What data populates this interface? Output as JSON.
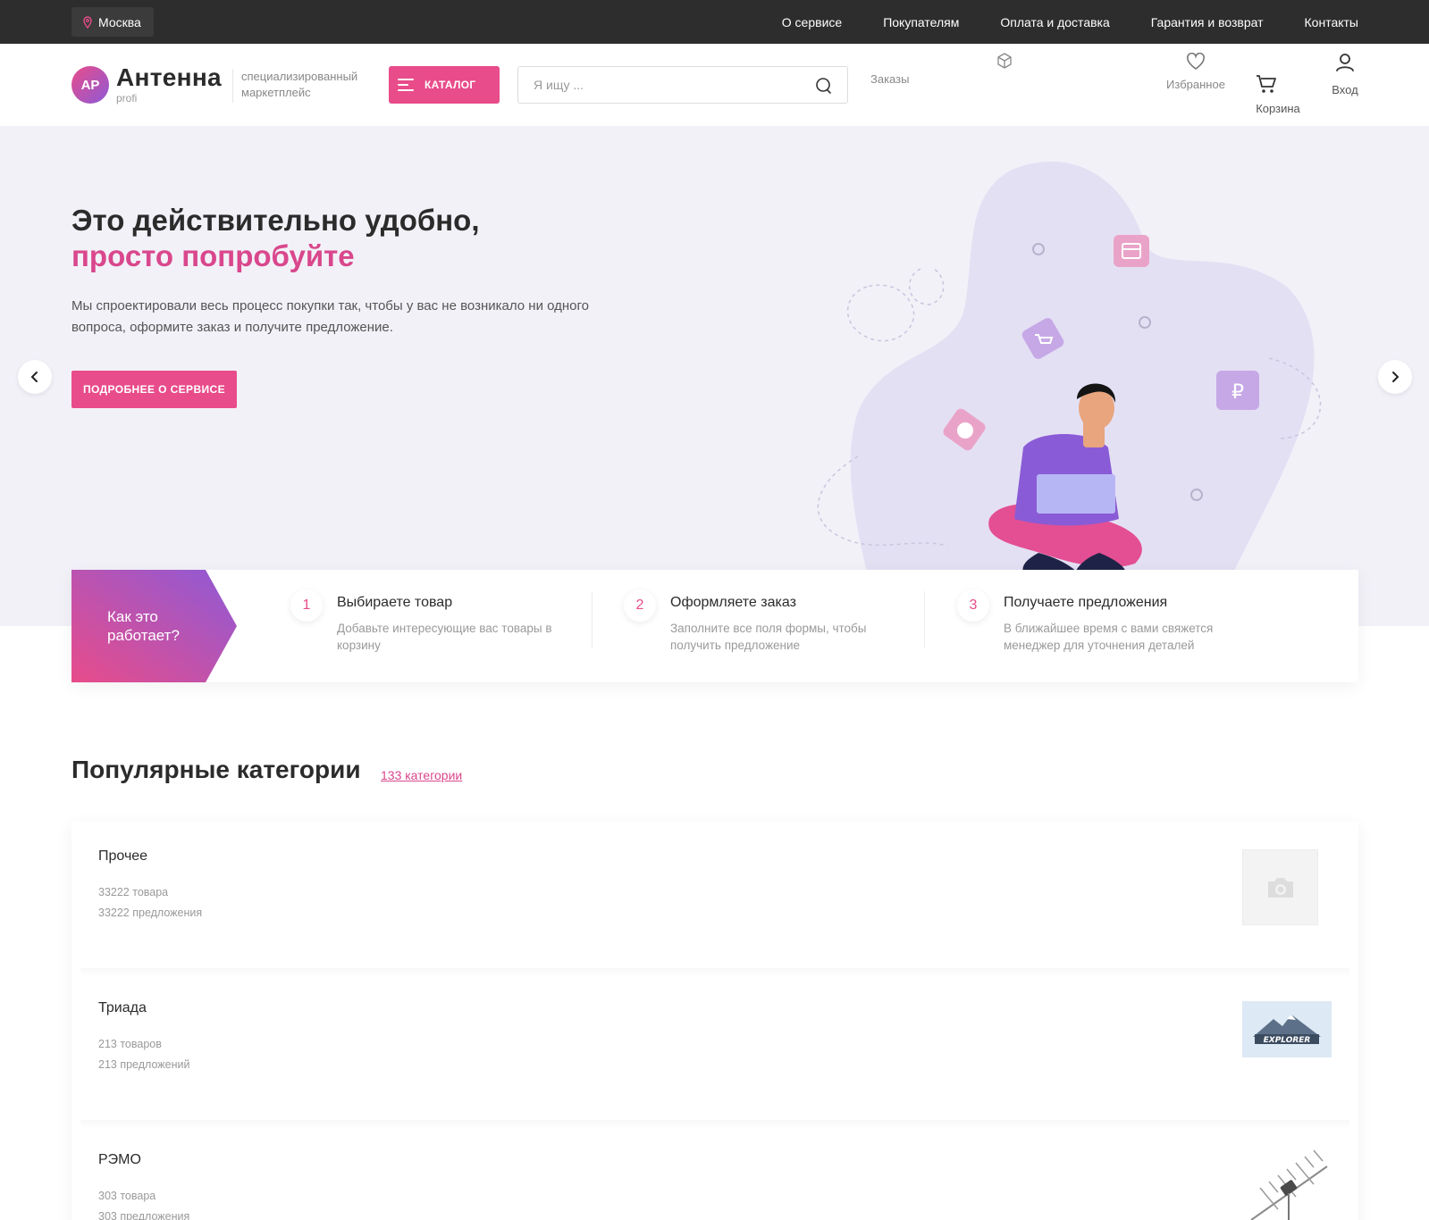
{
  "topbar": {
    "city": "Москва",
    "nav": [
      "О сервисе",
      "Покупателям",
      "Оплата и доставка",
      "Гарантия и возврат",
      "Контакты"
    ]
  },
  "header": {
    "logo_initials": "АР",
    "logo_name": "Антенна",
    "logo_sub": "profi",
    "tagline": "специализированный маркетплейс",
    "catalog_label": "КАТАЛОГ",
    "search_placeholder": "Я ищу ...",
    "orders_label": "Заказы",
    "favorites_label": "Избранное",
    "cart_label": "Корзина",
    "login_label": "Вход"
  },
  "hero": {
    "title_line1": "Это действительно удобно,",
    "title_line2": "просто попробуйте",
    "text": "Мы спроектировали весь процесс покупки так, чтобы у вас не возникало ни одного вопроса, оформите заказ и получите предложение.",
    "button": "ПОДРОБНЕЕ О СЕРВИСЕ"
  },
  "how": {
    "badge": "Как это работает?",
    "steps": [
      {
        "num": "1",
        "title": "Выбираете товар",
        "desc": "Добавьте интересующие вас товары в корзину"
      },
      {
        "num": "2",
        "title": "Оформляете заказ",
        "desc": "Заполните все поля формы, чтобы получить предложение"
      },
      {
        "num": "3",
        "title": "Получаете предложения",
        "desc": "В ближайшее время с вами свяжется менеджер для уточнения деталей"
      }
    ]
  },
  "popular": {
    "title": "Популярные категории",
    "link": "133 категории",
    "items": [
      {
        "name": "Прочее",
        "goods": "33222 товара",
        "offers": "33222 предложения"
      },
      {
        "name": "Триада",
        "goods": "213 товаров",
        "offers": "213 предложений",
        "brand_text": "EXPLORER"
      },
      {
        "name": "РЭМО",
        "goods": "303 товара",
        "offers": "303 предложения"
      }
    ]
  },
  "colors": {
    "accent": "#e84c8a",
    "accent_purple": "#8e5ad6",
    "topbar_bg": "#2d2d2d",
    "hero_bg": "#f2f1f8"
  }
}
